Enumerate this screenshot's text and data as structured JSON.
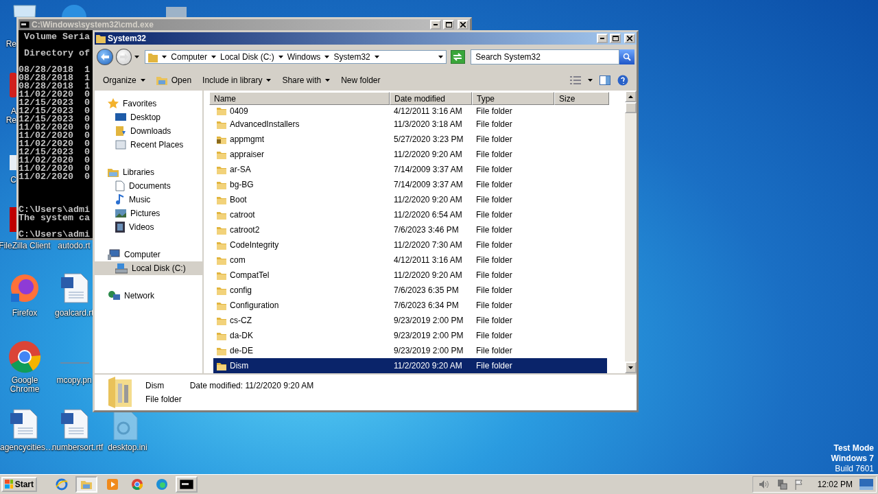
{
  "desktop_icons": [
    {
      "kind": "recycle_bin",
      "label": "Re"
    },
    {
      "kind": "app"
    },
    {
      "kind": "app_gray"
    },
    {
      "kind": "acrobat",
      "label": "A Re"
    },
    {
      "kind": "shortcut",
      "label": "C"
    },
    {
      "kind": "filezilla",
      "label": "FileZilla Client"
    },
    {
      "kind": "hidden",
      "label": "autodo.rt"
    },
    {
      "kind": "firefox",
      "label": "Firefox"
    },
    {
      "kind": "document",
      "label": "goalcard.rt"
    },
    {
      "kind": "chrome",
      "label": "Google Chrome"
    },
    {
      "kind": "image",
      "label": "mcopy.pn"
    },
    {
      "kind": "document",
      "label": "agencycities…"
    },
    {
      "kind": "document",
      "label": "numbersort.rtf"
    },
    {
      "kind": "settings_file",
      "label": "desktop.ini"
    }
  ],
  "console_window": {
    "title": "C:\\Windows\\system32\\cmd.exe",
    "blocks": [
      [
        " Volume Seria"
      ],
      [
        " Directory of"
      ],
      [
        "08/28/2018  1",
        "08/28/2018  1",
        "08/28/2018  1",
        "11/02/2020  0",
        "12/15/2023  0",
        "12/15/2023  0",
        "12/15/2023  0",
        "11/02/2020  0",
        "11/02/2020  0",
        "11/02/2020  0",
        "12/15/2023  0",
        "11/02/2020  0",
        "11/02/2020  0",
        "11/02/2020  0"
      ],
      [
        "C:\\Users\\admi",
        "The system ca"
      ],
      [
        "C:\\Users\\admi"
      ]
    ]
  },
  "explorer": {
    "title": "System32",
    "breadcrumbs": [
      "Computer",
      "Local Disk (C:)",
      "Windows",
      "System32"
    ],
    "search": {
      "placeholder": "Search System32"
    },
    "toolbar": [
      {
        "label": "Organize",
        "dropdown": true,
        "kind": "menu"
      },
      {
        "label": "Open",
        "dropdown": false,
        "kind": "open"
      },
      {
        "label": "Include in library",
        "dropdown": true,
        "kind": "menu"
      },
      {
        "label": "Share with",
        "dropdown": true,
        "kind": "menu"
      },
      {
        "label": "New folder",
        "dropdown": false,
        "kind": "menu"
      }
    ],
    "nav": [
      {
        "label": "Favorites",
        "kind": "star",
        "selected": false,
        "children": [
          {
            "label": "Desktop",
            "kind": "desktop",
            "selected": false
          },
          {
            "label": "Downloads",
            "kind": "downloads",
            "selected": false
          },
          {
            "label": "Recent Places",
            "kind": "recent",
            "selected": false
          }
        ]
      },
      {
        "label": "Libraries",
        "kind": "libraries",
        "selected": false,
        "children": [
          {
            "label": "Documents",
            "kind": "documents",
            "selected": false
          },
          {
            "label": "Music",
            "kind": "music",
            "selected": false
          },
          {
            "label": "Pictures",
            "kind": "pictures",
            "selected": false
          },
          {
            "label": "Videos",
            "kind": "videos",
            "selected": false
          }
        ]
      },
      {
        "label": "Computer",
        "kind": "computer",
        "selected": false,
        "children": [
          {
            "label": "Local Disk (C:)",
            "kind": "disk",
            "selected": true
          }
        ]
      },
      {
        "label": "Network",
        "kind": "network",
        "selected": false
      }
    ],
    "columns": [
      "Name",
      "Date modified",
      "Type",
      "Size"
    ],
    "rows": [
      {
        "name": "0409",
        "date": "4/12/2011 3:16 AM",
        "type": "File folder",
        "kind": "folder",
        "selected": false
      },
      {
        "name": "AdvancedInstallers",
        "date": "11/3/2020 3:18 AM",
        "type": "File folder",
        "kind": "folder",
        "selected": false
      },
      {
        "name": "appmgmt",
        "date": "5/27/2020 3:23 PM",
        "type": "File folder",
        "kind": "locked_folder",
        "selected": false
      },
      {
        "name": "appraiser",
        "date": "11/2/2020 9:20 AM",
        "type": "File folder",
        "kind": "folder",
        "selected": false
      },
      {
        "name": "ar-SA",
        "date": "7/14/2009 3:37 AM",
        "type": "File folder",
        "kind": "folder",
        "selected": false
      },
      {
        "name": "bg-BG",
        "date": "7/14/2009 3:37 AM",
        "type": "File folder",
        "kind": "folder",
        "selected": false
      },
      {
        "name": "Boot",
        "date": "11/2/2020 9:20 AM",
        "type": "File folder",
        "kind": "folder",
        "selected": false
      },
      {
        "name": "catroot",
        "date": "11/2/2020 6:54 AM",
        "type": "File folder",
        "kind": "folder",
        "selected": false
      },
      {
        "name": "catroot2",
        "date": "7/6/2023 3:46 PM",
        "type": "File folder",
        "kind": "folder",
        "selected": false
      },
      {
        "name": "CodeIntegrity",
        "date": "11/2/2020 7:30 AM",
        "type": "File folder",
        "kind": "folder",
        "selected": false
      },
      {
        "name": "com",
        "date": "4/12/2011 3:16 AM",
        "type": "File folder",
        "kind": "folder",
        "selected": false
      },
      {
        "name": "CompatTel",
        "date": "11/2/2020 9:20 AM",
        "type": "File folder",
        "kind": "folder",
        "selected": false
      },
      {
        "name": "config",
        "date": "7/6/2023 6:35 PM",
        "type": "File folder",
        "kind": "folder",
        "selected": false
      },
      {
        "name": "Configuration",
        "date": "7/6/2023 6:34 PM",
        "type": "File folder",
        "kind": "folder",
        "selected": false
      },
      {
        "name": "cs-CZ",
        "date": "9/23/2019 2:00 PM",
        "type": "File folder",
        "kind": "folder",
        "selected": false
      },
      {
        "name": "da-DK",
        "date": "9/23/2019 2:00 PM",
        "type": "File folder",
        "kind": "folder",
        "selected": false
      },
      {
        "name": "de-DE",
        "date": "9/23/2019 2:00 PM",
        "type": "File folder",
        "kind": "folder",
        "selected": false
      },
      {
        "name": "Dism",
        "date": "11/2/2020 9:20 AM",
        "type": "File folder",
        "kind": "folder",
        "selected": true
      }
    ],
    "details": {
      "name": "Dism",
      "date_label": "Date modified:",
      "date": "11/2/2020 9:20 AM",
      "type": "File folder"
    }
  },
  "watermark": {
    "lines": [
      {
        "text": "Test Mode",
        "bold": true
      },
      {
        "text": "Windows 7",
        "bold": true
      },
      {
        "text": "Build 7601",
        "bold": false
      }
    ]
  },
  "taskbar": {
    "start": "Start",
    "items": [
      {
        "kind": "ie",
        "open": false,
        "selected": false
      },
      {
        "kind": "explorer",
        "open": true,
        "selected": true
      },
      {
        "kind": "media",
        "open": false,
        "selected": false
      },
      {
        "kind": "chrome",
        "open": false,
        "selected": false
      },
      {
        "kind": "edge",
        "open": false,
        "selected": false
      },
      {
        "kind": "cmd",
        "open": true,
        "selected": false
      }
    ],
    "clock": "12:02 PM"
  }
}
